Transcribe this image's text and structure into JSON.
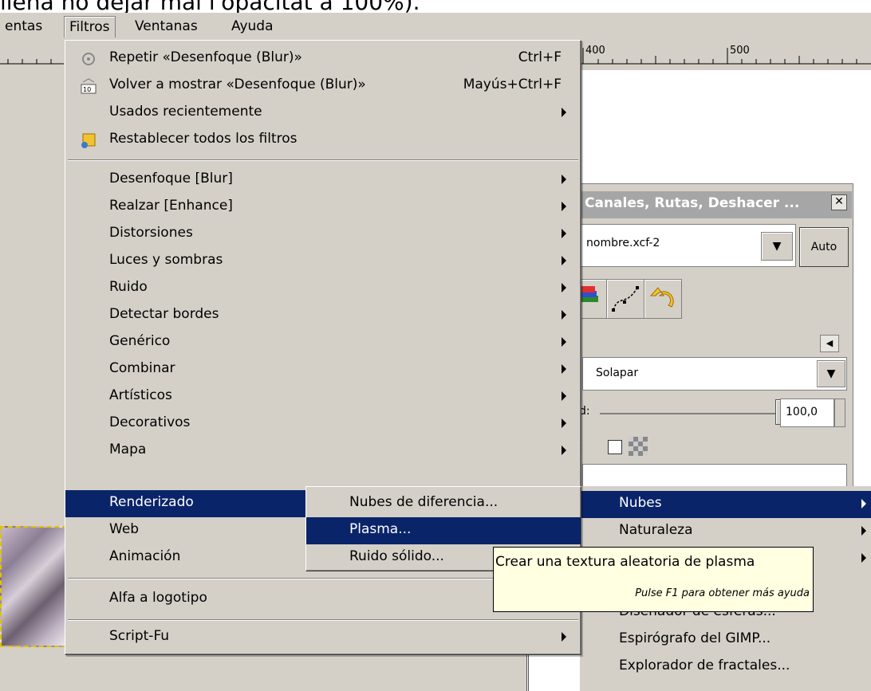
{
  "caption_text": "llena no dejar mal l'opacitat a 100%).",
  "menubar": {
    "items": [
      "entas",
      "Filtros",
      "Ventanas",
      "Ayuda"
    ]
  },
  "ruler": {
    "labels": [
      "400",
      "500"
    ]
  },
  "filters_menu": {
    "repeat": {
      "label": "Repetir «Desenfoque (Blur)»",
      "shortcut": "Ctrl+F"
    },
    "reshow": {
      "label": "Volver a mostrar «Desenfoque (Blur)»",
      "shortcut": "Mayús+Ctrl+F"
    },
    "recent": "Usados recientemente",
    "reset": "Restablecer todos los filtros",
    "categories": [
      "Desenfoque [Blur]",
      "Realzar [Enhance]",
      "Distorsiones",
      "Luces y sombras",
      "Ruido",
      "Detectar bordes",
      "Genérico",
      "Combinar",
      "Artísticos",
      "Decorativos",
      "Mapa",
      "Renderizado",
      "Web",
      "Animación"
    ],
    "alpha_logo": "Alfa a logotipo",
    "script_fu": "Script-Fu"
  },
  "render_submenu": [
    "Nubes de diferencia...",
    "Plasma...",
    "Ruido sólido..."
  ],
  "pattern_submenu": [
    "Nubes",
    "Naturaleza",
    "",
    "",
    "Diseñador de esferas...",
    "Espirógrafo del GIMP...",
    "Explorador de fractales..."
  ],
  "tooltip": {
    "main": "Crear una textura aleatoria de plasma",
    "help": "Pulse F1 para obtener más ayuda"
  },
  "dock": {
    "title": "Canales, Rutas, Deshacer ...",
    "close_glyph": "✕",
    "image_name": "nombre.xcf-2",
    "auto_label": "Auto",
    "mode": "Solapar",
    "opacity_label": "d:",
    "opacity_value": "100,0",
    "lock_label": ":"
  }
}
